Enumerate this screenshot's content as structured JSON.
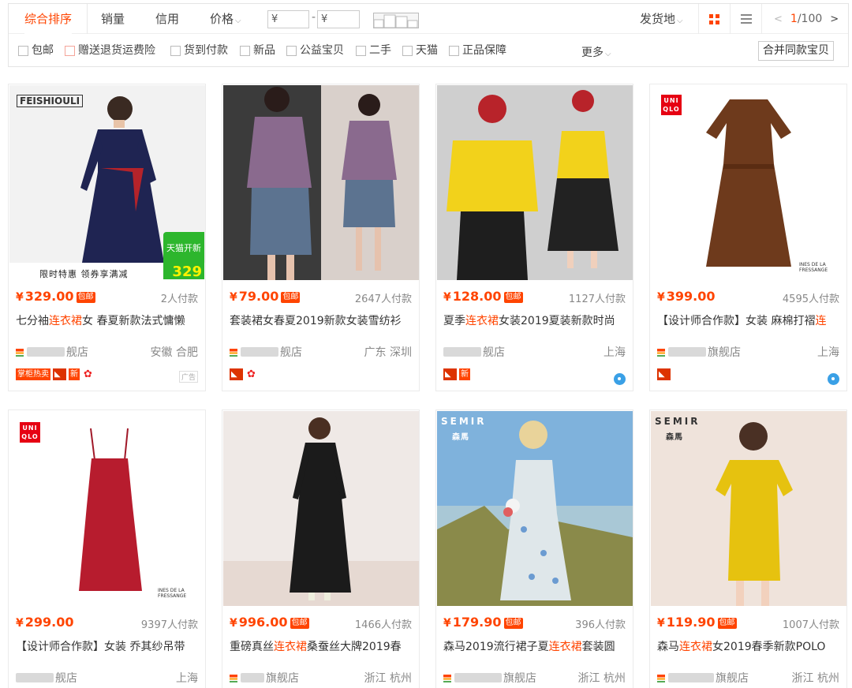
{
  "toolbar": {
    "sorts": [
      "综合排序",
      "销量",
      "信用",
      "价格"
    ],
    "price_from": "¥",
    "price_to": "¥",
    "price_dash": "-",
    "ship_from": "发货地",
    "page_current": "1",
    "page_total": "/100",
    "filters": [
      "包邮",
      "赠送退货运费险",
      "货到付款",
      "新品",
      "公益宝贝",
      "二手",
      "天猫",
      "正品保障"
    ],
    "more": "更多",
    "merge": "合并同款宝贝"
  },
  "products": [
    {
      "price": "329.00",
      "baoyou": "包邮",
      "sales": "2人付款",
      "title_pre": "七分袖",
      "title_hl": "连衣裙",
      "title_post": "女 春夏新款法式慵懒",
      "shop_blurred": "",
      "shop_suffix": "舰店",
      "location": "安徽 合肥",
      "image_brand": "FEISHIOULI",
      "image_banner": "限时特惠  领券享满减",
      "tmall_tag": "天猫开新",
      "image_price": "329",
      "badge_text": "掌柜热卖",
      "badge_new": "新",
      "ad": "广告"
    },
    {
      "price": "79.00",
      "baoyou": "包邮",
      "sales": "2647人付款",
      "title_pre": "套装裙女春夏2019新款女装雪纺衫",
      "title_hl": "",
      "title_post": "",
      "shop_blurred": "",
      "shop_suffix": "舰店",
      "location": "广东 深圳"
    },
    {
      "price": "128.00",
      "baoyou": "包邮",
      "sales": "1127人付款",
      "title_pre": "夏季",
      "title_hl": "连衣裙",
      "title_post": "女装2019夏装新款时尚",
      "shop_blurred": "",
      "shop_suffix": "舰店",
      "location": "上海",
      "badge_new": "新"
    },
    {
      "price": "399.00",
      "baoyou": "",
      "sales": "4595人付款",
      "title_pre": "【设计师合作款】女装 麻棉打褶",
      "title_hl": "连",
      "title_post": "",
      "shop_blurred": "",
      "shop_suffix": "旗舰店",
      "location": "上海",
      "image_brand": "UNI QLO",
      "image_sub": "INES DE LA FRESSANGE"
    },
    {
      "price": "299.00",
      "baoyou": "",
      "sales": "9397人付款",
      "title_pre": "【设计师合作款】女装 乔其纱吊带",
      "title_hl": "",
      "title_post": "",
      "shop_blurred": "",
      "shop_suffix": "舰店",
      "location": "上海",
      "image_brand": "UNI QLO",
      "image_sub": "INES DE LA FRESSANGE"
    },
    {
      "price": "996.00",
      "baoyou": "包邮",
      "sales": "1466人付款",
      "title_pre": "重磅真丝",
      "title_hl": "连衣裙",
      "title_post": "桑蚕丝大牌2019春",
      "shop_blurred": "",
      "shop_suffix": "旗舰店",
      "location": "浙江 杭州"
    },
    {
      "price": "179.90",
      "baoyou": "包邮",
      "sales": "396人付款",
      "title_pre": "森马2019流行裙子夏",
      "title_hl": "连衣裙",
      "title_post": "套装圆",
      "shop_blurred": "",
      "shop_suffix": "旗舰店",
      "location": "浙江 杭州",
      "image_brand": "SEMIR",
      "image_sub": "森馬"
    },
    {
      "price": "119.90",
      "baoyou": "包邮",
      "sales": "1007人付款",
      "title_pre": "森马",
      "title_hl": "连衣裙",
      "title_post": "女2019春季新款POLO",
      "shop_blurred": "",
      "shop_suffix": "旗舰店",
      "location": "浙江 杭州",
      "image_brand": "SEMIR",
      "image_sub": "森馬"
    }
  ],
  "colors": {
    "accent": "#ff4400",
    "tmall_red": "#dd2200",
    "card_border": "#ebebeb"
  }
}
